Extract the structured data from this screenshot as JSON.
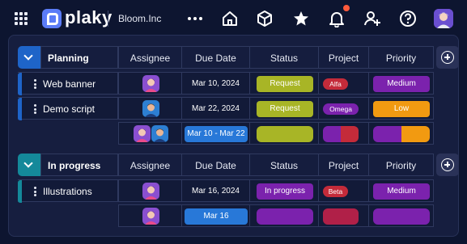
{
  "app": {
    "brand": "plaky",
    "workspace": "Bloom.Inc"
  },
  "nav_icons": [
    "grid-menu-icon",
    "more-icon",
    "home-icon",
    "cube-icon",
    "star-icon",
    "bell-icon",
    "add-user-icon",
    "help-icon",
    "user-avatar-icon"
  ],
  "columns": {
    "assignee": "Assignee",
    "due_date": "Due Date",
    "status": "Status",
    "project": "Project",
    "priority": "Priority"
  },
  "colors": {
    "planning": "#1e64c8",
    "in_progress": "#14899a",
    "status_request": "#a8b526",
    "status_in_progress": "#7b22ad",
    "project_alfa": "#c42b3a",
    "project_omega": "#7b22ad",
    "project_beta": "#c42b3a",
    "priority_medium": "#7b22ad",
    "priority_low": "#f29a11",
    "date_summary": "#2878d8"
  },
  "groups": [
    {
      "name": "Planning",
      "items": [
        {
          "name": "Web banner",
          "due_date": "Mar 10, 2024",
          "status": "Request",
          "project": "Alfa",
          "priority": "Medium"
        },
        {
          "name": "Demo script",
          "due_date": "Mar 22, 2024",
          "status": "Request",
          "project": "Omega",
          "priority": "Low"
        }
      ],
      "summary": {
        "date_range": "Mar 10 - Mar 22"
      }
    },
    {
      "name": "In progress",
      "items": [
        {
          "name": "Illustrations",
          "due_date": "Mar 16, 2024",
          "status": "In progress",
          "project": "Beta",
          "priority": "Medium"
        }
      ],
      "summary": {
        "date_range": "Mar 16"
      }
    }
  ]
}
